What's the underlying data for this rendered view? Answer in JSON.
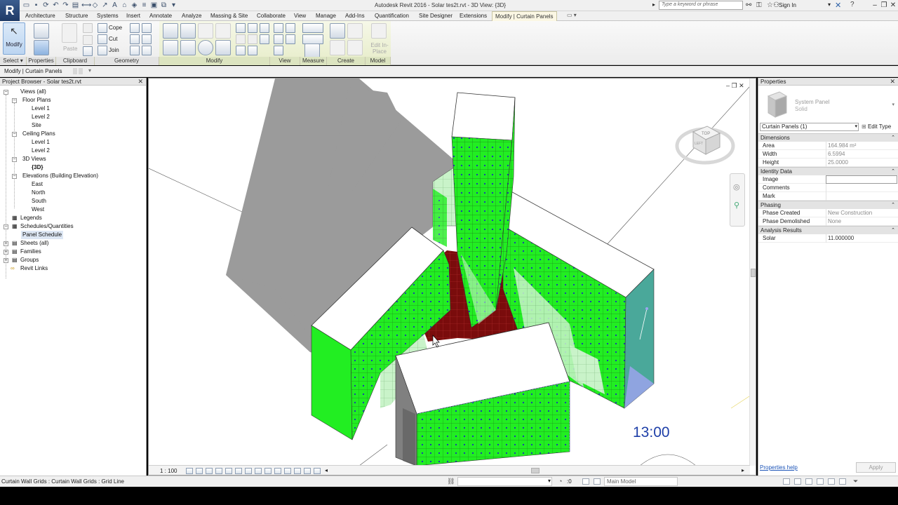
{
  "titlebar": {
    "app_logo": "R",
    "title": "Autodesk Revit 2016 -      Solar tes2t.rvt - 3D View: {3D}",
    "search_placeholder": "Type a keyword or phrase",
    "signin": "Sign In"
  },
  "tabs": [
    {
      "label": "Architecture"
    },
    {
      "label": "Structure"
    },
    {
      "label": "Systems"
    },
    {
      "label": "Insert"
    },
    {
      "label": "Annotate"
    },
    {
      "label": "Analyze"
    },
    {
      "label": "Massing & Site"
    },
    {
      "label": "Collaborate"
    },
    {
      "label": "View"
    },
    {
      "label": "Manage"
    },
    {
      "label": "Add-Ins"
    },
    {
      "label": "Quantification"
    },
    {
      "label": "Site Designer"
    },
    {
      "label": "Extensions"
    },
    {
      "label": "Modify | Curtain Panels"
    }
  ],
  "ribbon": {
    "modify_label": "Modify",
    "paste_label": "Paste",
    "cope_label": "Cope",
    "cut_label": "Cut",
    "join_label": "Join",
    "edit_inplace_label": "Edit In-Place",
    "groups": [
      {
        "label": "Select ▾"
      },
      {
        "label": "Properties"
      },
      {
        "label": "Clipboard"
      },
      {
        "label": "Geometry"
      },
      {
        "label": "Modify"
      },
      {
        "label": "View"
      },
      {
        "label": "Measure"
      },
      {
        "label": "Create"
      },
      {
        "label": "Model"
      }
    ]
  },
  "options_bar": {
    "label": "Modify | Curtain Panels"
  },
  "project_browser": {
    "title": "Project Browser - Solar tes2t.rvt",
    "items": [
      {
        "label": "Views (all)"
      },
      {
        "label": "Floor Plans"
      },
      {
        "label": "Level 1"
      },
      {
        "label": "Level 2"
      },
      {
        "label": "Site"
      },
      {
        "label": "Ceiling Plans"
      },
      {
        "label": "Level 1"
      },
      {
        "label": "Level 2"
      },
      {
        "label": "3D Views"
      },
      {
        "label": "{3D}"
      },
      {
        "label": "Elevations (Building Elevation)"
      },
      {
        "label": "East"
      },
      {
        "label": "North"
      },
      {
        "label": "South"
      },
      {
        "label": "West"
      },
      {
        "label": "Legends"
      },
      {
        "label": "Schedules/Quantities"
      },
      {
        "label": "Panel Schedule"
      },
      {
        "label": "Sheets (all)"
      },
      {
        "label": "Families"
      },
      {
        "label": "Groups"
      },
      {
        "label": "Revit Links"
      }
    ]
  },
  "viewport": {
    "time": "13:00",
    "scale": "1 : 100",
    "viewcube_top": "TOP",
    "viewcube_left": "LEFT"
  },
  "properties": {
    "title": "Properties",
    "type_name": "System Panel",
    "type_sub": "Solid",
    "instance": "Curtain Panels (1)",
    "edit_type": "Edit Type",
    "sections": [
      {
        "title": "Dimensions",
        "rows": [
          {
            "k": "Area",
            "v": "164.984 m²"
          },
          {
            "k": "Width",
            "v": "6.5994"
          },
          {
            "k": "Height",
            "v": "25.0000"
          }
        ]
      },
      {
        "title": "Identity Data",
        "rows": [
          {
            "k": "Image",
            "v": ""
          },
          {
            "k": "Comments",
            "v": ""
          },
          {
            "k": "Mark",
            "v": ""
          }
        ]
      },
      {
        "title": "Phasing",
        "rows": [
          {
            "k": "Phase Created",
            "v": "New Construction"
          },
          {
            "k": "Phase Demolished",
            "v": "None"
          }
        ]
      },
      {
        "title": "Analysis Results",
        "rows": [
          {
            "k": "Solar",
            "v": "11.000000"
          }
        ]
      }
    ],
    "help": "Properties help",
    "apply": "Apply"
  },
  "statusbar": {
    "text": "Curtain Wall Grids : Curtain Wall Grids : Grid Line",
    "zero": ":0",
    "model": "Main Model"
  },
  "colors": {
    "panel_green": "#22ee22",
    "panel_light": "#ccf5cc",
    "shadow": "#9a9a9a",
    "red_glass": "#7a0c0c",
    "teal": "#4aa89a",
    "time_blue": "#1e3fa8"
  }
}
